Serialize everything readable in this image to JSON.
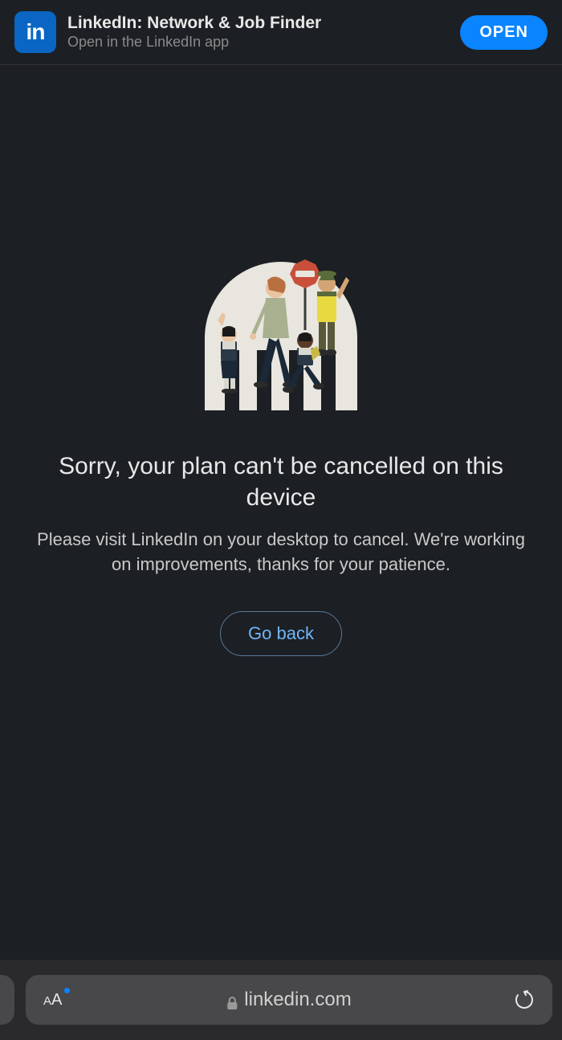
{
  "banner": {
    "icon_text": "in",
    "title": "LinkedIn: Network & Job Finder",
    "subtitle": "Open in the LinkedIn app",
    "open_label": "OPEN"
  },
  "main": {
    "heading": "Sorry, your plan can't be cancelled on this device",
    "description": "Please visit LinkedIn on your desktop to cancel. We're working on improvements, thanks for your patience.",
    "go_back_label": "Go back"
  },
  "browser": {
    "url": "linkedin.com",
    "text_size_label_small": "A",
    "text_size_label_large": "A"
  }
}
